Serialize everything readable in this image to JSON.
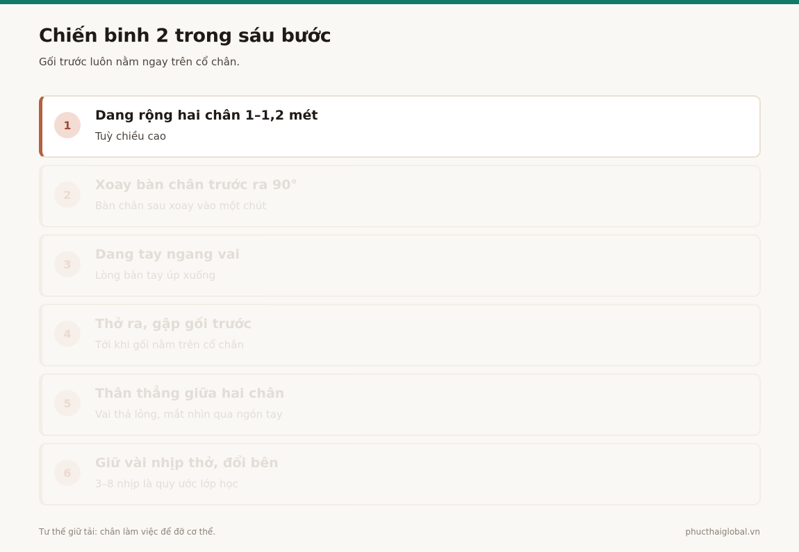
{
  "colors": {
    "top_bar": "#0f7a6a",
    "accent": "#b5603f",
    "background": "#faf8f4"
  },
  "header": {
    "title": "Chiến binh 2 trong sáu bước",
    "subtitle": "Gối trước luôn nằm ngay trên cổ chân."
  },
  "steps": [
    {
      "number": "1",
      "title": "Dang rộng hai chân 1–1,2 mét",
      "subtitle": "Tuỳ chiều cao",
      "active": true
    },
    {
      "number": "2",
      "title": "Xoay bàn chân trước ra 90°",
      "subtitle": "Bàn chân sau xoay vào một chút",
      "active": false
    },
    {
      "number": "3",
      "title": "Dang tay ngang vai",
      "subtitle": "Lòng bàn tay úp xuống",
      "active": false
    },
    {
      "number": "4",
      "title": "Thở ra, gập gối trước",
      "subtitle": "Tới khi gối nằm trên cổ chân",
      "active": false
    },
    {
      "number": "5",
      "title": "Thân thẳng giữa hai chân",
      "subtitle": "Vai thả lỏng, mắt nhìn qua ngón tay",
      "active": false
    },
    {
      "number": "6",
      "title": "Giữ vài nhịp thở, đổi bên",
      "subtitle": "3–8 nhịp là quy ước lớp học",
      "active": false
    }
  ],
  "footer": {
    "note": "Tư thế giữ tải: chân làm việc để đỡ cơ thể.",
    "domain": "phucthaiglobal.vn"
  }
}
